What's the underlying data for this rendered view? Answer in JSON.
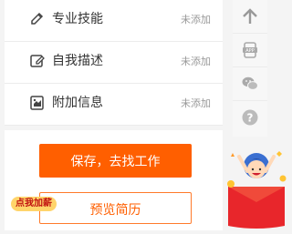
{
  "sections": [
    {
      "label": "专业技能",
      "status": "未添加",
      "icon": "pen-icon"
    },
    {
      "label": "自我描述",
      "status": "未添加",
      "icon": "edit-icon"
    },
    {
      "label": "附加信息",
      "status": "未添加",
      "icon": "info-icon"
    }
  ],
  "actions": {
    "save_label": "保存，去找工作",
    "preview_label": "预览简历"
  },
  "rail": {
    "items": [
      "back-to-top-icon",
      "app-icon",
      "wechat-icon",
      "help-icon"
    ]
  },
  "promo": {
    "label": "点我加薪"
  },
  "colors": {
    "accent": "#ff5f00",
    "muted_text": "#999999"
  }
}
